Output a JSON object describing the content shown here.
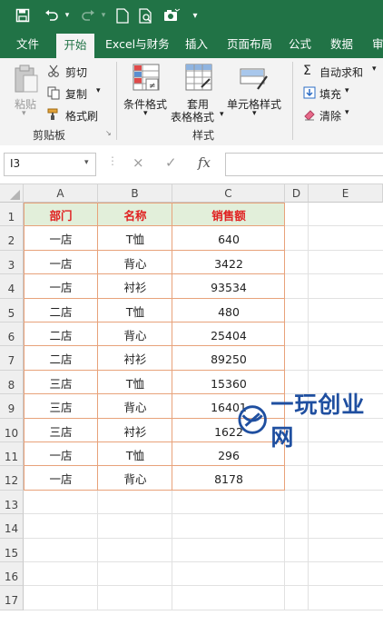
{
  "quick_access": {
    "icons": [
      "save-icon",
      "undo-icon",
      "redo-icon",
      "new-file-icon",
      "print-preview-icon",
      "camera-icon",
      "customize-icon"
    ]
  },
  "tabs": [
    "文件",
    "开始",
    "Excel与财务",
    "插入",
    "页面布局",
    "公式",
    "数据",
    "审"
  ],
  "active_tab": "开始",
  "ribbon": {
    "paste": "粘贴",
    "cut": "剪切",
    "copy": "复制",
    "format_painter": "格式刷",
    "clipboard_group": "剪贴板",
    "conditional_format": "条件格式",
    "table_format_1": "套用",
    "table_format_2": "表格格式",
    "cell_style": "单元格样式",
    "styles_group": "样式",
    "autosum": "自动求和",
    "fill": "填充",
    "clear": "清除"
  },
  "formula_bar": {
    "name_box": "I3",
    "cancel": "×",
    "enter": "✓",
    "fx": "fx",
    "value": ""
  },
  "grid": {
    "columns": [
      "A",
      "B",
      "C",
      "D",
      "E"
    ],
    "rows": [
      "1",
      "2",
      "3",
      "4",
      "5",
      "6",
      "7",
      "8",
      "9",
      "10",
      "11",
      "12",
      "13",
      "14",
      "15",
      "16",
      "17"
    ],
    "headers": [
      "部门",
      "名称",
      "销售额"
    ],
    "data": [
      [
        "一店",
        "T恤",
        "640"
      ],
      [
        "一店",
        "背心",
        "3422"
      ],
      [
        "一店",
        "衬衫",
        "93534"
      ],
      [
        "二店",
        "T恤",
        "480"
      ],
      [
        "二店",
        "背心",
        "25404"
      ],
      [
        "二店",
        "衬衫",
        "89250"
      ],
      [
        "三店",
        "T恤",
        "15360"
      ],
      [
        "三店",
        "背心",
        "16401"
      ],
      [
        "三店",
        "衬衫",
        "1622"
      ],
      [
        "一店",
        "T恤",
        "296"
      ],
      [
        "一店",
        "背心",
        "8178"
      ]
    ]
  },
  "colors": {
    "brand": "#217346",
    "header_text": "#e02020",
    "header_fill": "#e2efda",
    "table_border": "#e8a27a",
    "watermark": "#1f4fa0"
  },
  "watermark": "一玩创业网"
}
